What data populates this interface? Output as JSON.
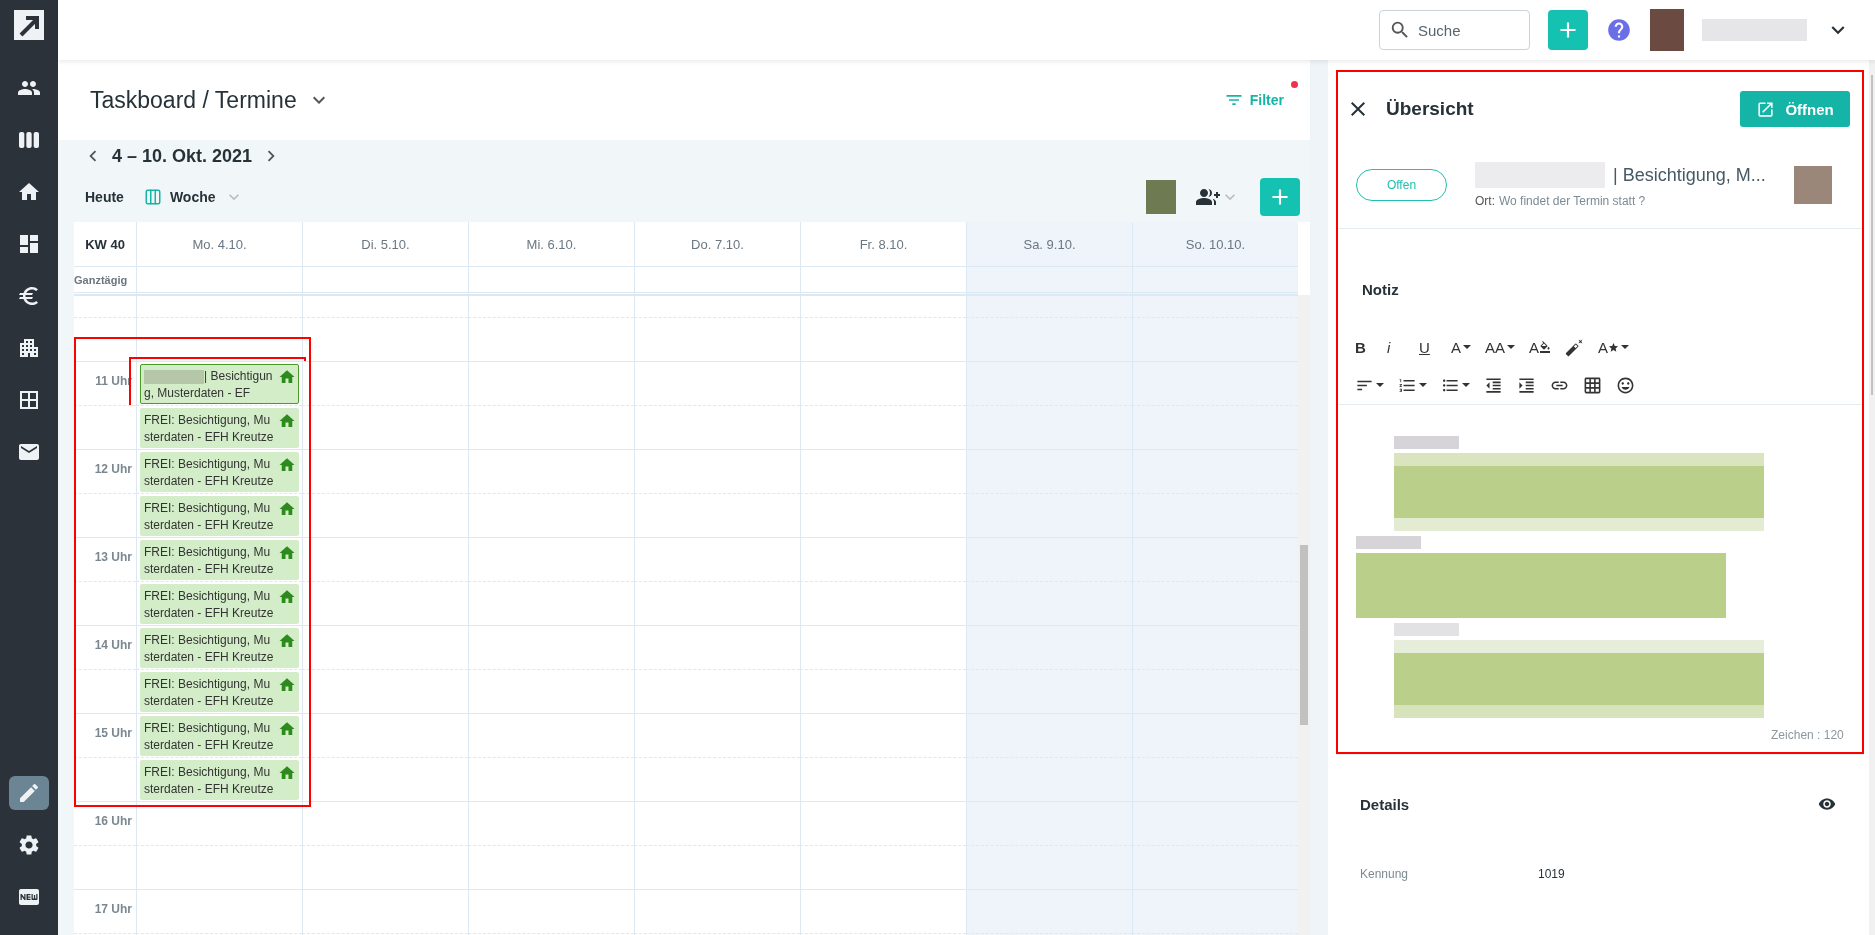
{
  "topbar": {
    "search": {
      "placeholder": "Suche"
    }
  },
  "page": {
    "title": "Taskboard / Termine",
    "filter": {
      "label": "Filter",
      "active": true
    }
  },
  "calendar": {
    "range": "4 – 10. Okt. 2021",
    "today": "Heute",
    "view": "Woche",
    "week": "KW 40",
    "allday": "Ganztägig",
    "days": [
      {
        "label": "Mo. 4.10.",
        "weekend": false
      },
      {
        "label": "Di. 5.10.",
        "weekend": false
      },
      {
        "label": "Mi. 6.10.",
        "weekend": false
      },
      {
        "label": "Do. 7.10.",
        "weekend": false
      },
      {
        "label": "Fr. 8.10.",
        "weekend": false
      },
      {
        "label": "Sa. 9.10.",
        "weekend": true
      },
      {
        "label": "So. 10.10.",
        "weekend": true
      }
    ],
    "hours": [
      "11 Uhr",
      "12 Uhr",
      "13 Uhr",
      "14 Uhr",
      "15 Uhr",
      "16 Uhr",
      "17 Uhr"
    ],
    "events_highlighted": true,
    "events": [
      {
        "text": "| Besichtigung, Musterdaten - EF",
        "redacted_prefix": true,
        "selected": true
      },
      {
        "text": "FREI: Besichtigung, Musterdaten - EFH Kreutze",
        "redacted_prefix": false,
        "selected": false
      },
      {
        "text": "FREI: Besichtigung, Musterdaten - EFH Kreutze",
        "redacted_prefix": false,
        "selected": false
      },
      {
        "text": "FREI: Besichtigung, Musterdaten - EFH Kreutze",
        "redacted_prefix": false,
        "selected": false
      },
      {
        "text": "FREI: Besichtigung, Musterdaten - EFH Kreutze",
        "redacted_prefix": false,
        "selected": false
      },
      {
        "text": "FREI: Besichtigung, Musterdaten - EFH Kreutze",
        "redacted_prefix": false,
        "selected": false
      },
      {
        "text": "FREI: Besichtigung, Musterdaten - EFH Kreutze",
        "redacted_prefix": false,
        "selected": false
      },
      {
        "text": "FREI: Besichtigung, Musterdaten - EFH Kreutze",
        "redacted_prefix": false,
        "selected": false
      },
      {
        "text": "FREI: Besichtigung, Musterdaten - EFH Kreutze",
        "redacted_prefix": false,
        "selected": false
      },
      {
        "text": "FREI: Besichtigung, Musterdaten - EFH Kreutze",
        "redacted_prefix": false,
        "selected": false
      }
    ]
  },
  "panel": {
    "highlighted": true,
    "title": "Übersicht",
    "open_button": "Öffnen",
    "status": "Offen",
    "subject": "| Besichtigung, M...",
    "location_label": "Ort:",
    "location": "Wo findet der Termin statt ?",
    "note": {
      "heading": "Notiz",
      "format_tools": [
        "B",
        "i",
        "U",
        "A",
        "AA",
        "A",
        "A"
      ],
      "count": "Zeichen : 120"
    },
    "details": {
      "heading": "Details",
      "fields": [
        {
          "label": "Kennung",
          "value": "1019"
        }
      ]
    }
  }
}
